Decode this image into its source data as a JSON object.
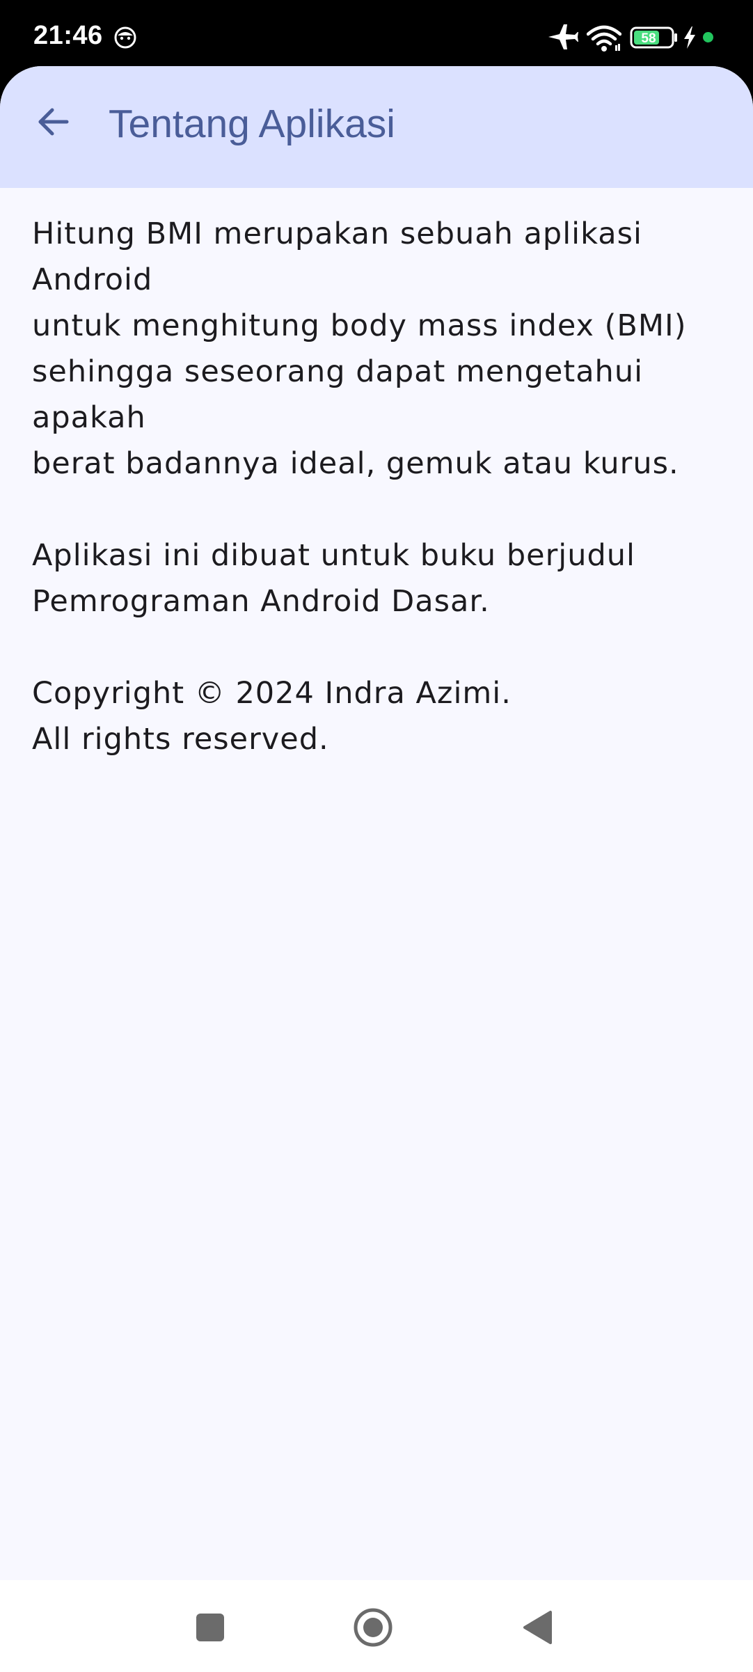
{
  "status_bar": {
    "time": "21:46",
    "battery_level": "58",
    "icons": [
      "face-icon",
      "airplane-mode-icon",
      "wifi-icon",
      "battery-icon",
      "charging-bolt-icon",
      "status-dot-icon"
    ]
  },
  "app_bar": {
    "back_icon": "arrow-back-icon",
    "title": "Tentang Aplikasi"
  },
  "content": {
    "paragraphs": [
      "Hitung BMI merupakan sebuah aplikasi Android\nuntuk menghitung body mass index (BMI)\nsehingga seseorang dapat mengetahui apakah\nberat badannya ideal, gemuk atau kurus.",
      "Aplikasi ini dibuat untuk buku berjudul\nPemrograman Android Dasar.",
      "Copyright © 2024 Indra Azimi.\nAll rights reserved."
    ]
  },
  "navigation_bar": {
    "buttons": [
      "recents-icon",
      "home-icon",
      "back-triangle-icon"
    ]
  },
  "colors": {
    "app_bar_bg": "#dbe1ff",
    "title": "#4a5d98",
    "content_bg": "#f8f8ff",
    "text": "#1c1b1f",
    "nav_icon": "#6b6b6b"
  }
}
